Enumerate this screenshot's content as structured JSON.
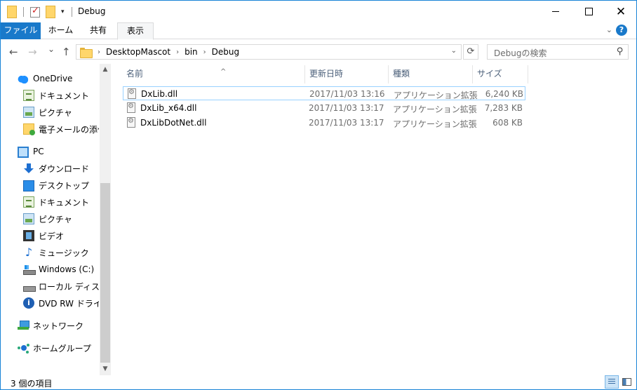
{
  "window": {
    "title": "Debug",
    "controls": {
      "minimize": "—",
      "maximize": "☐",
      "close": "✕"
    }
  },
  "ribbon": {
    "tabs": [
      {
        "label": "ファイル"
      },
      {
        "label": "ホーム"
      },
      {
        "label": "共有"
      },
      {
        "label": "表示"
      }
    ],
    "help": "?"
  },
  "navigation": {
    "back": "←",
    "forward": "→",
    "recent": "⌄",
    "up": "↑",
    "breadcrumb": [
      "DesktopMascot",
      "bin",
      "Debug"
    ],
    "refresh": "⟳",
    "search_placeholder": "Debugの検索"
  },
  "sidebar": {
    "onedrive": "OneDrive",
    "onedrive_items": [
      "ドキュメント",
      "ピクチャ",
      "電子メールの添付"
    ],
    "pc": "PC",
    "pc_items": [
      "ダウンロード",
      "デスクトップ",
      "ドキュメント",
      "ピクチャ",
      "ビデオ",
      "ミュージック",
      "Windows (C:)",
      "ローカル ディスク (D",
      "DVD RW ドライブ ("
    ],
    "network": "ネットワーク",
    "homegroup": "ホームグループ"
  },
  "file_list": {
    "columns": [
      "名前",
      "更新日時",
      "種類",
      "サイズ"
    ],
    "rows": [
      {
        "name": "DxLib.dll",
        "date": "2017/11/03 13:16",
        "type": "アプリケーション拡張",
        "size": "6,240 KB"
      },
      {
        "name": "DxLib_x64.dll",
        "date": "2017/11/03 13:17",
        "type": "アプリケーション拡張",
        "size": "7,283 KB"
      },
      {
        "name": "DxLibDotNet.dll",
        "date": "2017/11/03 13:17",
        "type": "アプリケーション拡張",
        "size": "608 KB"
      }
    ]
  },
  "status": {
    "item_count": "3 個の項目"
  },
  "colors": {
    "accent": "#1979ca",
    "selection_border": "#99d1ff",
    "header_text": "#4c607a"
  }
}
